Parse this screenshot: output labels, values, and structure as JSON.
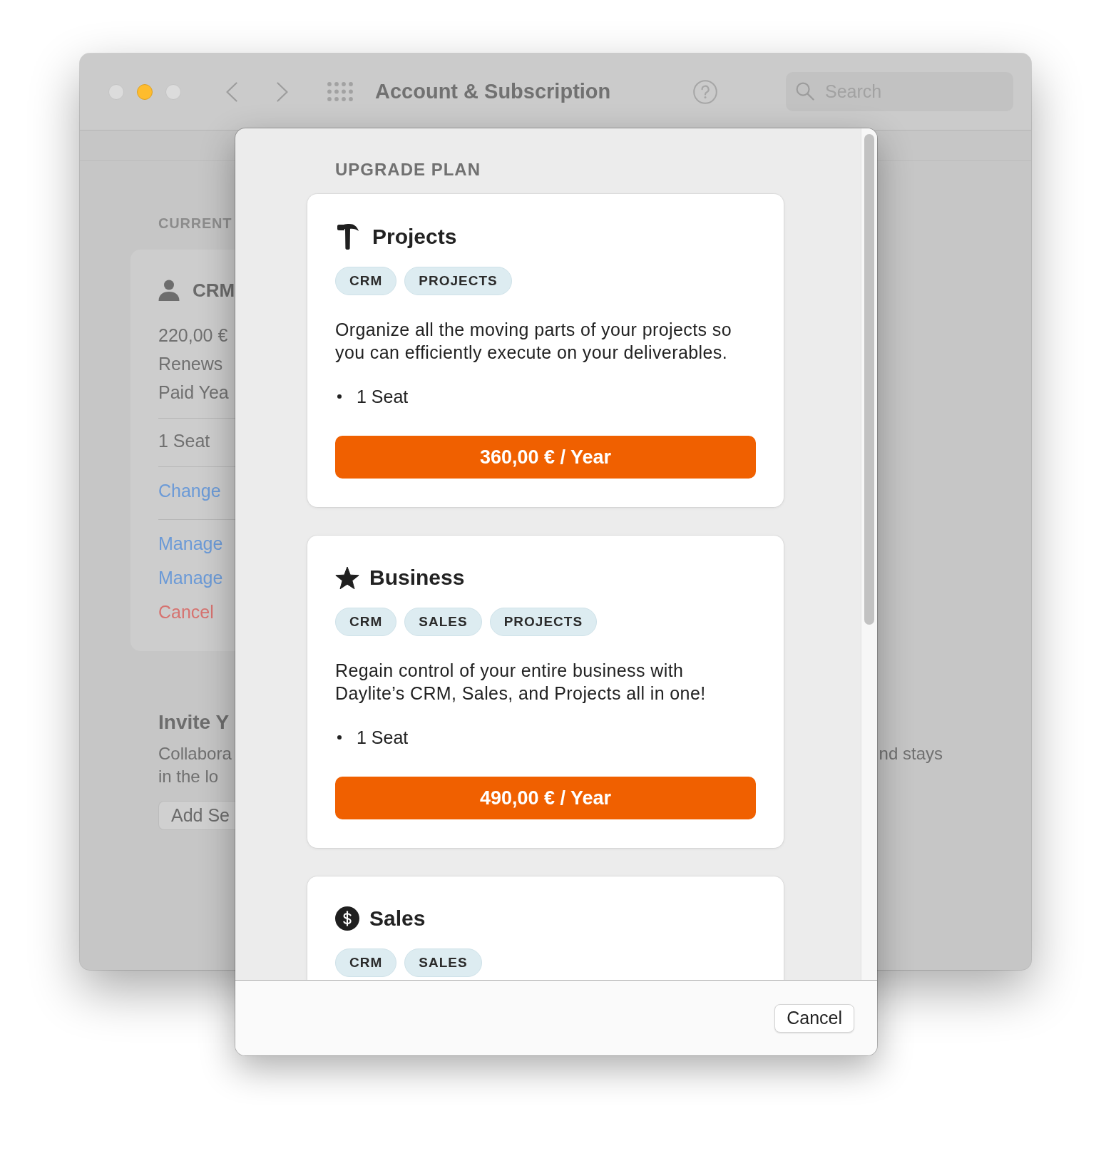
{
  "window": {
    "traffic_lights": [
      {
        "disabled": true
      },
      {
        "disabled": false
      },
      {
        "disabled": true
      }
    ],
    "title": "Account & Subscription",
    "search": {
      "placeholder": "Search"
    }
  },
  "current_plan": {
    "section_label": "CURRENT",
    "name": "CRM",
    "details": [
      "220,00 €",
      "Renews",
      "Paid Yea"
    ],
    "seats": "1 Seat",
    "action_groups": [
      {
        "actions": [
          {
            "label": "Change",
            "kind": "link"
          }
        ]
      },
      {
        "actions": [
          {
            "label": "Manage",
            "kind": "link"
          },
          {
            "label": "Manage",
            "kind": "link"
          },
          {
            "label": "Cancel",
            "kind": "destructive"
          }
        ]
      }
    ]
  },
  "invite": {
    "title": "Invite Y",
    "lines": [
      {
        "text": "Collabora",
        "trailing": "nd stays"
      },
      {
        "text": "in the lo"
      }
    ],
    "button": "Add Se"
  },
  "sheet": {
    "heading": "UPGRADE PLAN",
    "plans": [
      {
        "kind": "projects",
        "name": "Projects",
        "tags": [
          "CRM",
          "PROJECTS"
        ],
        "description": "Organize all the moving parts of your projects so you can efficiently execute on your deliverables.",
        "features": [
          "1 Seat"
        ],
        "price": "360,00 € / Year"
      },
      {
        "kind": "business",
        "name": "Business",
        "tags": [
          "CRM",
          "SALES",
          "PROJECTS"
        ],
        "description": "Regain control of your entire business with Daylite’s CRM, Sales, and Projects all in one!",
        "features": [
          "1 Seat"
        ],
        "price": "490,00 € / Year"
      },
      {
        "kind": "sales",
        "name": "Sales",
        "tags": [
          "CRM",
          "SALES"
        ]
      }
    ],
    "cancel": "Cancel"
  }
}
